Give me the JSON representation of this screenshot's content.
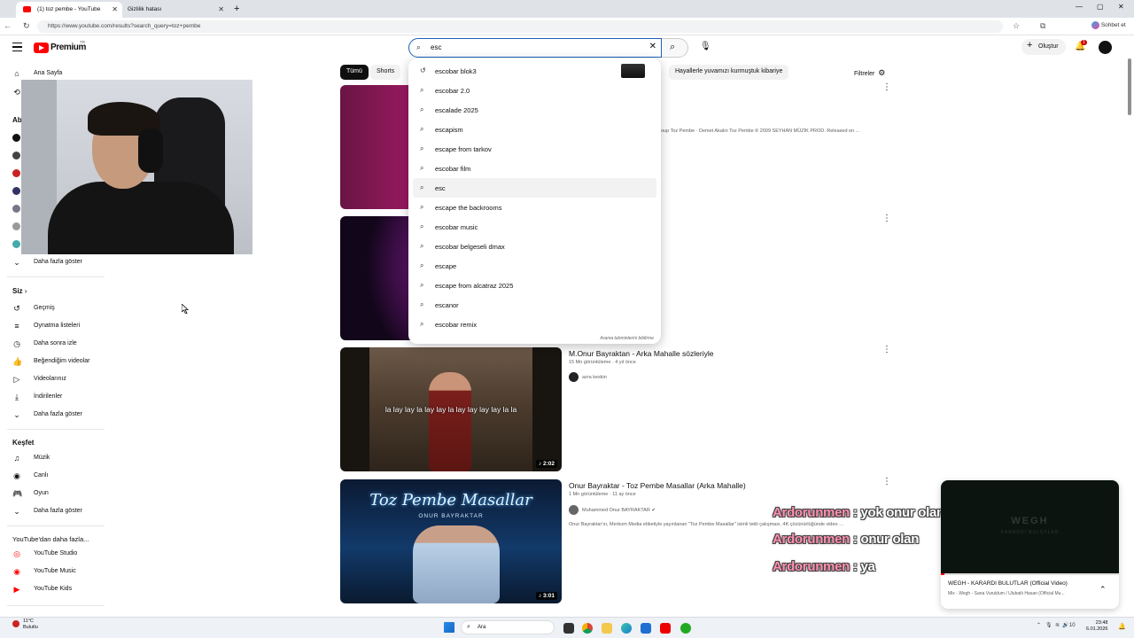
{
  "browser": {
    "tabs": [
      {
        "label": "(1) toz pembe - YouTube",
        "active": true
      },
      {
        "label": "Gizlilik hatası",
        "active": false
      }
    ],
    "url": "https://www.youtube.com/results?search_query=toz+pembe",
    "profile_button": "Sohbet et"
  },
  "header": {
    "logo_text": "Premium",
    "logo_sup": "TR",
    "search_value": "esc",
    "create_label": "Oluştur",
    "notification_count": "1"
  },
  "sidebar": {
    "home": "Ana Sayfa",
    "subs_head": "Ab",
    "show_more_subs": "Daha fazla göster",
    "you_head": "Siz",
    "you_items": [
      "Geçmiş",
      "Oynatma listeleri",
      "Daha sonra izle",
      "Beğendiğim videolar",
      "Videolarınız",
      "İndirilenler",
      "Daha fazla göster"
    ],
    "explore_head": "Keşfet",
    "explore_items": [
      "Müzik",
      "Canlı",
      "Oyun",
      "Daha fazla göster"
    ],
    "more_head": "YouTube'dan daha fazla...",
    "more_items": [
      "YouTube Studio",
      "YouTube Music",
      "YouTube Kids"
    ]
  },
  "chips": {
    "all": "Tümü",
    "shorts": "Shorts",
    "last": "Hayallerle yuvamızı kurmuştuk kibariye",
    "filters": "Filtreler"
  },
  "suggestions": [
    {
      "prefix": "esc",
      "rest": "obar blok3",
      "history": true
    },
    {
      "prefix": "esc",
      "rest": "obar 2.0",
      "history": false
    },
    {
      "prefix": "esc",
      "rest": "alade 2025",
      "history": false
    },
    {
      "prefix": "esc",
      "rest": "apism",
      "history": false
    },
    {
      "prefix": "esc",
      "rest": "ape from tarkov",
      "history": false
    },
    {
      "prefix": "esc",
      "rest": "obar film",
      "history": false
    },
    {
      "prefix": "esc",
      "rest": "",
      "history": false
    },
    {
      "prefix": "esc",
      "rest": "ape the backrooms",
      "history": false
    },
    {
      "prefix": "esc",
      "rest": "obar music",
      "history": false
    },
    {
      "prefix": "esc",
      "rest": "obar belgeseli dmax",
      "history": false
    },
    {
      "prefix": "esc",
      "rest": "ape",
      "history": false
    },
    {
      "prefix": "esc",
      "rest": "ape from alcatraz 2025",
      "history": false
    },
    {
      "prefix": "esc",
      "rest": "anor",
      "history": false
    },
    {
      "prefix": "esc",
      "rest": "obar remix",
      "history": false
    }
  ],
  "report_link": "Arama tahminlerini bildirme",
  "videos": [
    {
      "desc": "oup Toz Pembe · Demet Akalın Toz Pembe ℗ 2009 SEYHAN MÜZİK PROD. Released on ..."
    },
    {},
    {
      "title": "M.Onur Bayraktan - Arka Mahalle sözleriyle",
      "meta": "15 Mn görüntüleme · 4 yıl önce",
      "channel": "azra keskin",
      "thumb_caption": "la lay lay la lay lay la lay lay lay lay la la",
      "duration": "2:02"
    },
    {
      "title": "Onur Bayraktar - Toz Pembe Masallar (Arka Mahalle)",
      "meta": "1 Mn görüntüleme · 11 ay önce",
      "channel": "Muhammed Onur BAYRAKTAR ✔",
      "desc": "Onur Bayraktar'ın, Merkom Media etiketiyle yayınlanan \"Toz Pembe Masallar\" isimli tekli çalışması, 4K çözünürlüğünde video ...",
      "thumb_title": "Toz Pembe Masallar",
      "thumb_sub": "ONUR BAYRAKTAR",
      "duration": "3:01"
    }
  ],
  "chat": [
    {
      "user": "Ardorunmen",
      "msg": ": yok onur olan"
    },
    {
      "user": "Ardorunmen",
      "msg": ": onur olan"
    },
    {
      "user": "Ardorunmen",
      "msg": ": ya"
    }
  ],
  "miniplayer": {
    "title": "WEGH - KARARDI BULUTLAR (Official Video)",
    "sub": "Mix - Wegh - Sana Vuruldum / Ulubatlı Hasan (Official Mu...",
    "thumb_text": "WEGH",
    "thumb_sub": "KARARDI BULUTLAR"
  },
  "taskbar": {
    "weather_temp": "11°C",
    "weather_desc": "Bulutlu",
    "search": "Ara",
    "time": "23:48",
    "date": "6.01.2026",
    "volume": "10"
  }
}
